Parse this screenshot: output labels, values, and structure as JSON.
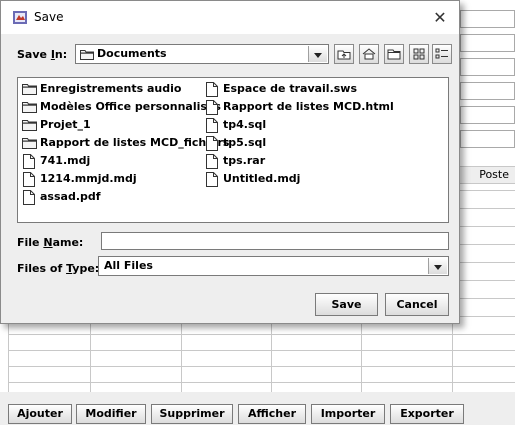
{
  "dialog": {
    "title": "Save",
    "save_in_label_pre": "Save ",
    "save_in_label_ul": "I",
    "save_in_label_post": "n:",
    "save_in_value": "Documents",
    "files": [
      {
        "name": "Enregistrements audio",
        "kind": "folder"
      },
      {
        "name": "Modèles Office personnalisés",
        "kind": "folder"
      },
      {
        "name": "Projet_1",
        "kind": "folder"
      },
      {
        "name": "Rapport de listes MCD_fichiers",
        "kind": "folder"
      },
      {
        "name": "741.mdj",
        "kind": "file"
      },
      {
        "name": "1214.mmjd.mdj",
        "kind": "file"
      },
      {
        "name": "assad.pdf",
        "kind": "file"
      },
      {
        "name": "Espace de travail.sws",
        "kind": "file"
      },
      {
        "name": "Rapport de listes MCD.html",
        "kind": "file"
      },
      {
        "name": "tp4.sql",
        "kind": "file"
      },
      {
        "name": "tp5.sql",
        "kind": "file"
      },
      {
        "name": "tps.rar",
        "kind": "file"
      },
      {
        "name": "Untitled.mdj",
        "kind": "file"
      }
    ],
    "file_name_label_pre": "File ",
    "file_name_label_ul": "N",
    "file_name_label_post": "ame:",
    "file_name_value": "",
    "files_of_type_label_pre": "Files of ",
    "files_of_type_label_ul": "T",
    "files_of_type_label_post": "ype:",
    "files_of_type_value": "All Files",
    "save_button": "Save",
    "cancel_button": "Cancel",
    "icons": [
      "up-one-level-icon",
      "home-icon",
      "new-folder-icon",
      "list-view-icon",
      "details-view-icon",
      "close-icon"
    ]
  },
  "background": {
    "column_header": "Poste",
    "buttons": [
      "Ajouter",
      "Modifier",
      "Supprimer",
      "Afficher",
      "Importer",
      "Exporter"
    ]
  }
}
